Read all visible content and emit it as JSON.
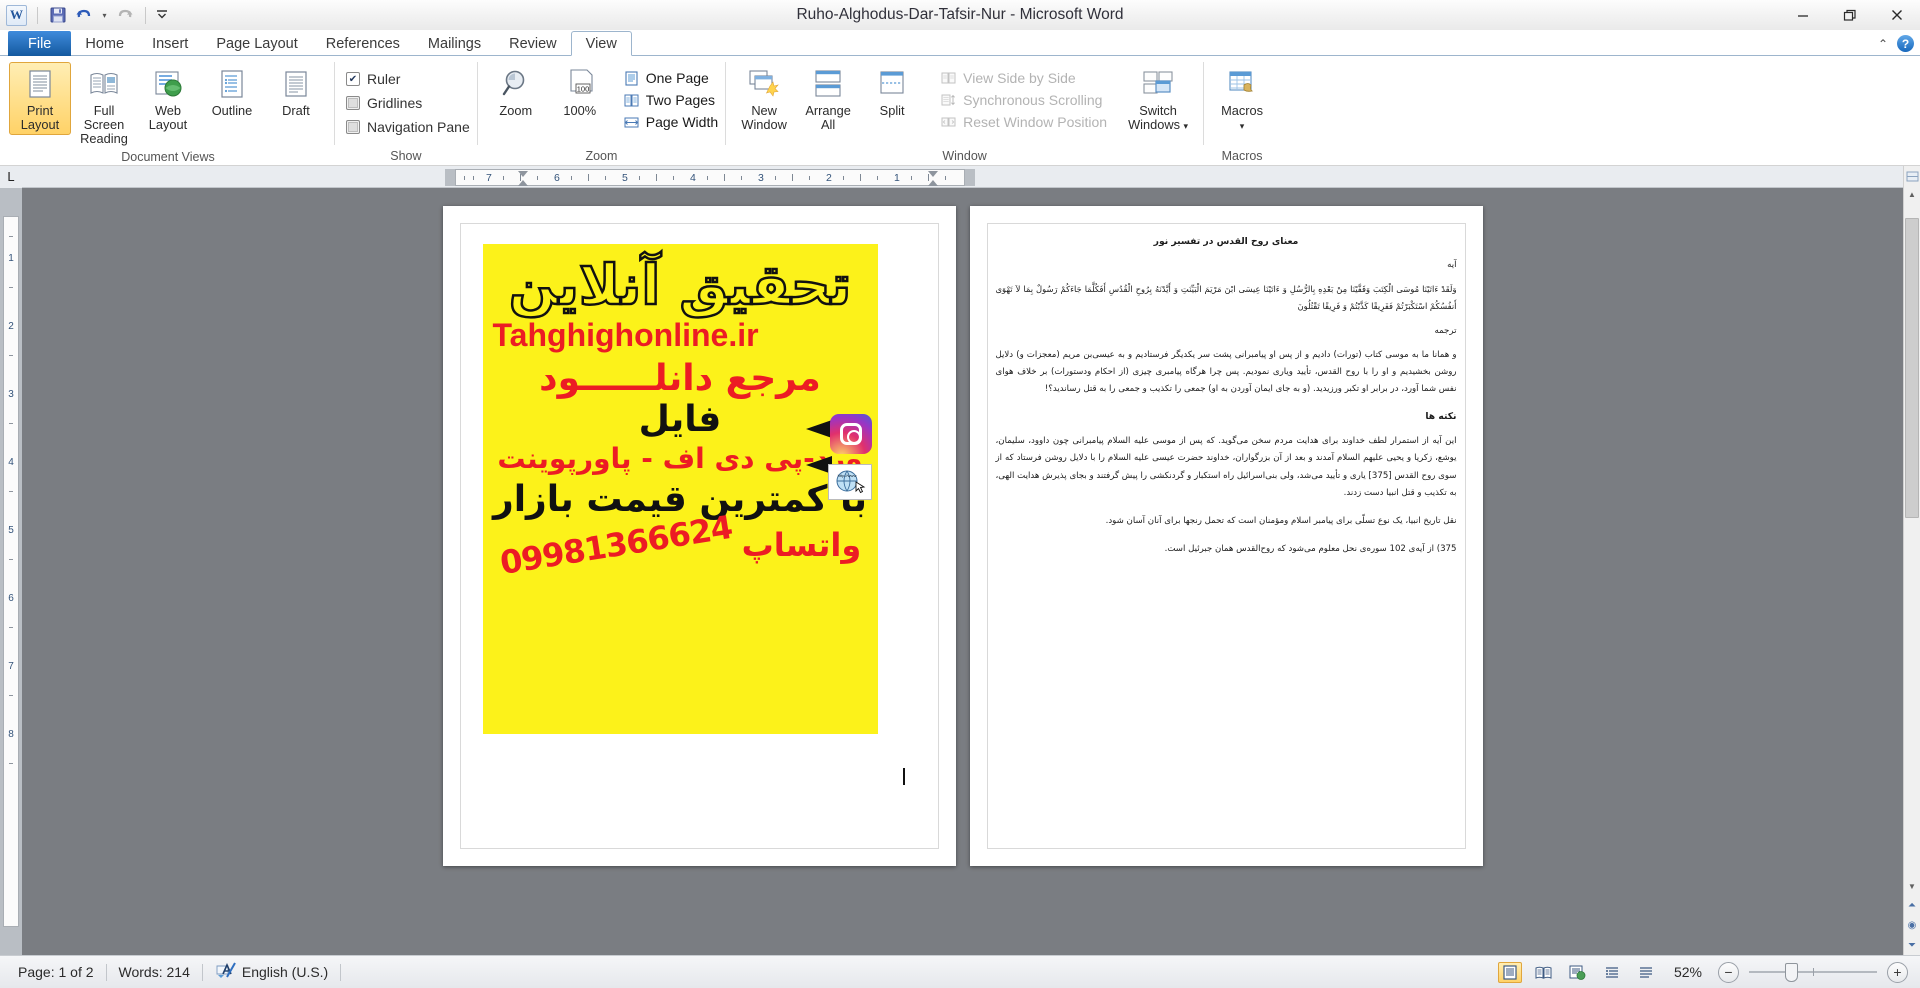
{
  "window": {
    "title": "Ruho-Alghodus-Dar-Tafsir-Nur  -  Microsoft Word",
    "minimize": "—",
    "restore": "restore-icon",
    "close": "✕"
  },
  "quick_access": {
    "logo": "W",
    "save": "💾",
    "undo": "↶",
    "undo_caret": "▾",
    "redo": "↷",
    "customize": "▾"
  },
  "ribbon": {
    "tabs": [
      {
        "label": "File",
        "active": false
      },
      {
        "label": "Home",
        "active": false
      },
      {
        "label": "Insert",
        "active": false
      },
      {
        "label": "Page Layout",
        "active": false
      },
      {
        "label": "References",
        "active": false
      },
      {
        "label": "Mailings",
        "active": false
      },
      {
        "label": "Review",
        "active": false
      },
      {
        "label": "View",
        "active": true
      }
    ],
    "right_icons": {
      "minimize_ribbon": "⌃",
      "help": "?"
    },
    "groups": [
      {
        "label": "Document Views",
        "buttons": [
          {
            "label": "Print Layout",
            "selected": true,
            "icon": "print-layout-icon"
          },
          {
            "label": "Full Screen Reading",
            "selected": false,
            "icon": "full-screen-reading-icon"
          },
          {
            "label": "Web Layout",
            "selected": false,
            "icon": "web-layout-icon"
          },
          {
            "label": "Outline",
            "selected": false,
            "icon": "outline-icon"
          },
          {
            "label": "Draft",
            "selected": false,
            "icon": "draft-icon"
          }
        ]
      },
      {
        "label": "Show",
        "checkboxes": [
          {
            "label": "Ruler",
            "checked": true
          },
          {
            "label": "Gridlines",
            "checked": false
          },
          {
            "label": "Navigation Pane",
            "checked": false
          }
        ]
      },
      {
        "label": "Zoom",
        "buttons": [
          {
            "label": "Zoom",
            "icon": "magnifier-icon"
          },
          {
            "label": "100%",
            "icon": "zoom-100-icon"
          }
        ],
        "small_items": [
          {
            "label": "One Page",
            "icon": "one-page-icon",
            "disabled": false
          },
          {
            "label": "Two Pages",
            "icon": "two-pages-icon",
            "disabled": false
          },
          {
            "label": "Page Width",
            "icon": "page-width-icon",
            "disabled": false
          }
        ]
      },
      {
        "label": "Window",
        "buttons": [
          {
            "label": "New Window",
            "icon": "new-window-icon"
          },
          {
            "label": "Arrange All",
            "icon": "arrange-all-icon"
          },
          {
            "label": "Split",
            "icon": "split-icon"
          }
        ],
        "small_items": [
          {
            "label": "View Side by Side",
            "icon": "side-by-side-icon",
            "disabled": true
          },
          {
            "label": "Synchronous Scrolling",
            "icon": "sync-scroll-icon",
            "disabled": true
          },
          {
            "label": "Reset Window Position",
            "icon": "reset-window-icon",
            "disabled": true
          }
        ],
        "switch_windows": {
          "label": "Switch Windows",
          "caret": "▾",
          "icon": "switch-windows-icon"
        }
      },
      {
        "label": "Macros",
        "macros": {
          "label": "Macros",
          "caret": "▾",
          "icon": "macros-icon"
        }
      }
    ]
  },
  "ruler": {
    "tab_selector": "L",
    "numbers": [
      "7",
      "6",
      "5",
      "4",
      "3",
      "2",
      "1"
    ],
    "vertical_numbers": [
      "1",
      "2",
      "3",
      "4",
      "5",
      "6",
      "7",
      "8"
    ]
  },
  "document": {
    "page1": {
      "advert": {
        "title": "تحقیق آنلاین",
        "url": "Tahghighonline.ir",
        "line3": "مرجع دانلــــــود",
        "line4": "فایل",
        "line5": "ورد-پی دی اف - پاورپوینت",
        "line6": "با کمترین قیمت بازار",
        "phone": "09981366624",
        "whatsapp": "واتساپ",
        "instagram_icon": "instagram-icon",
        "website_icon": "website-icon",
        "bg_color": "#fcf21a",
        "red_color": "#ec1c24",
        "black_color": "#111111"
      }
    },
    "page2": {
      "heading": "معنای روح القدس در تفسیر نور",
      "section_ayah": "آیه",
      "ayah_text": "وَلَقَدْ ءَاتَیْنَا مُوسَی الْکِتَبَ وَقَفَّیْنَا مِنْ بَعْدِهِ بِالرُّسُلِ وَ ءَاتَیْنَا عِیسَی ابْنَ مَرْیَمَ الْبَیِّنَتِ وَ أَیَّدْنَهُ بِرُوحِ الْقُدُسِ أَفَکُلَّمَا جَاءَکُمْ رَسُولٌ بِمَا لاَ تَهْوَی أَنفُسُکُمْ اسْتَکْبَرْتُمْ فَفَرِیقًا کَذَّبْتُمْ وَ فَرِیقًا تَقْتُلُونَ",
      "section_translation": "ترجمه",
      "translation_text": "و همانا ما به موسی کتاب (تورات) دادیم و از پس او پیامبرانی پشت سر یکدیگر فرستادیم و به عیسی‌بن مریم (معجزات و) دلایل روشن بخشیدیم و او را با روح القدس، تأیید ویاری نمودیم. پس چرا هرگاه پیامبری چیزی (از احکام ودستورات) بر خلاف هوای نفس شما آورد، در برابر او تکبر ورزیدید. (و به جای ایمان آوردن به او) جمعی را تکذیب و جمعی را به قتل رساندید؟!",
      "section_notes": "نکته ها",
      "note1": "این آیه از استمرار لطف خداوند برای هدایت مردم سخن می‌گوید. که پس از موسی علیه السلام پیامبرانی چون داوود، سلیمان، یوشع، زکریا و یحیی علیهم السلام آمدند و بعد از آن بزرگواران، خداوند حضرت عیسی علیه السلام را با دلایل روشن فرستاد که از سوی روح القدس [375] یاری و تأیید می‌شد، ولی بنی‌اسرائیل راه استکبار و گردنکشی را پیش گرفتند و بجای پذیرش هدایت الهی، به تکذیب و قتل انبیا دست زدند.",
      "note2": "نقل تاریخ انبیا، یک نوع تسلّی برای پیامبر اسلام ومؤمنان است که تحمل رنجها برای آنان آسان شود.",
      "footnote": "375) از آیه‌ی 102 سوره‌ی نحل معلوم می‌شود که روح‌القدس همان جبرئیل است."
    }
  },
  "status_bar": {
    "page": "Page: 1 of 2",
    "words": "Words: 214",
    "proofing_icon": "spell-check-icon",
    "language": "English (U.S.)",
    "view_buttons": [
      {
        "name": "print-layout",
        "icon": "▤",
        "selected": true
      },
      {
        "name": "full-screen-reading",
        "icon": "📖",
        "selected": false
      },
      {
        "name": "web-layout",
        "icon": "▥",
        "selected": false
      },
      {
        "name": "outline",
        "icon": "≣",
        "selected": false
      },
      {
        "name": "draft",
        "icon": "≡",
        "selected": false
      }
    ],
    "zoom_level": "52%",
    "zoom_out": "−",
    "zoom_in": "+"
  }
}
